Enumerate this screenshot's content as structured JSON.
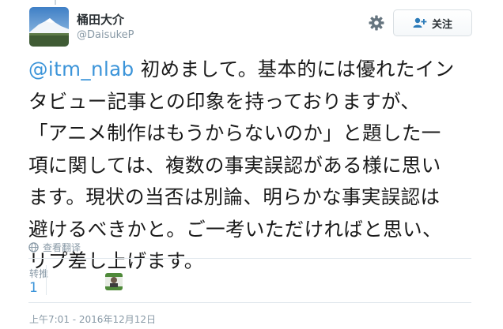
{
  "user": {
    "display_name": "桶田大介",
    "handle": "@DaisukeP",
    "avatar_icon": "mountain-landscape-avatar"
  },
  "actions": {
    "settings_icon": "gear-icon",
    "follow_icon": "add-user-icon",
    "follow_label": "关注",
    "follow_color": "#2b7bb9"
  },
  "tweet": {
    "mention": "@itm_nlab",
    "line1_rest": " 初めまして。基本的には優れたイン",
    "line2": "タビュー記事との印象を持っておりますが、",
    "line3": "「アニメ制作はもうからないのか」と題した一",
    "line4": "項に関しては、複数の事実誤認がある様に思い",
    "line5": "ます。現状の当否は別論、明らかな事実誤認は",
    "line6": "避けるべきかと。ご一考いただければと思い、",
    "line7": "リプ差し上げます。",
    "mention_color": "#3b94d9"
  },
  "translate": {
    "icon": "globe-icon",
    "label": "查看翻译"
  },
  "stats": {
    "retweets_label": "转推",
    "retweets_count": "1",
    "retweeter_avatar_icon": "retweeter-avatar"
  },
  "timestamp": "上午7:01 - 2016年12月12日"
}
